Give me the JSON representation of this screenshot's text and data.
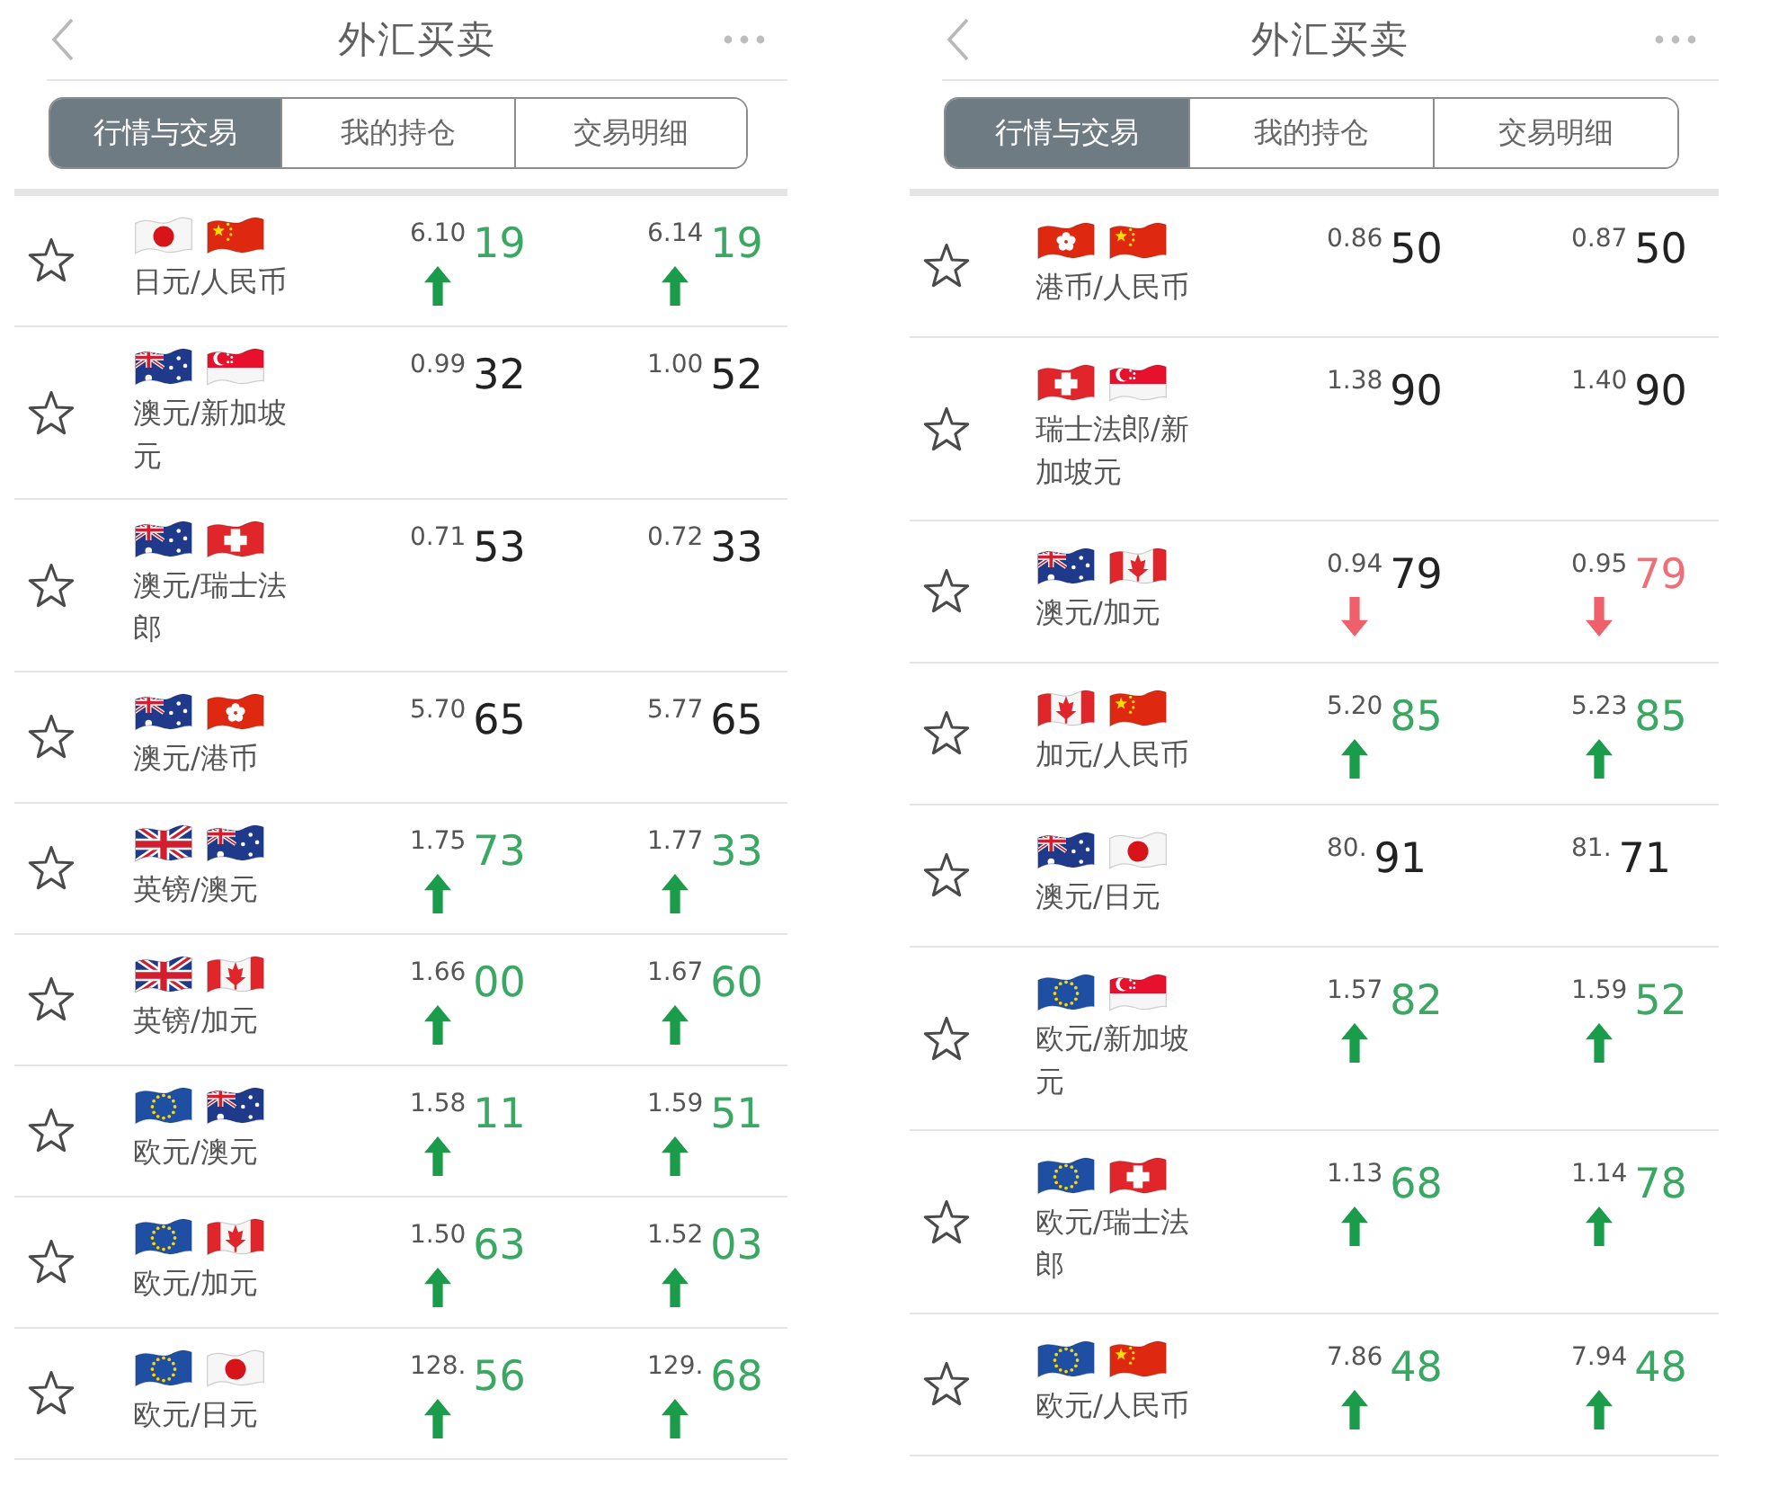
{
  "panels": [
    {
      "header": {
        "title": "外汇买卖"
      },
      "tabs": [
        {
          "label": "行情与交易",
          "selected": true
        },
        {
          "label": "我的持仓",
          "selected": false
        },
        {
          "label": "交易明细",
          "selected": false
        }
      ],
      "rows": [
        {
          "starred": false,
          "flags": [
            {
              "kind": "japan"
            },
            {
              "kind": "china"
            }
          ],
          "pair": "日元/人民币",
          "quotes": [
            {
              "lead": "6.10",
              "pips": "19",
              "color": "#3aa862",
              "rising": true,
              "falling": false
            },
            {
              "lead": "6.14",
              "pips": "19",
              "color": "#3aa862",
              "rising": true,
              "falling": false
            }
          ]
        },
        {
          "starred": false,
          "flags": [
            {
              "kind": "australia"
            },
            {
              "kind": "singapore"
            }
          ],
          "pair": "澳元/新加坡元",
          "quotes": [
            {
              "lead": "0.99",
              "pips": "32",
              "color": "#222222",
              "rising": false,
              "falling": false
            },
            {
              "lead": "1.00",
              "pips": "52",
              "color": "#222222",
              "rising": false,
              "falling": false
            }
          ]
        },
        {
          "starred": false,
          "flags": [
            {
              "kind": "australia"
            },
            {
              "kind": "switzerland"
            }
          ],
          "pair": "澳元/瑞士法郎",
          "quotes": [
            {
              "lead": "0.71",
              "pips": "53",
              "color": "#222222",
              "rising": false,
              "falling": false
            },
            {
              "lead": "0.72",
              "pips": "33",
              "color": "#222222",
              "rising": false,
              "falling": false
            }
          ]
        },
        {
          "starred": false,
          "flags": [
            {
              "kind": "australia"
            },
            {
              "kind": "hongkong"
            }
          ],
          "pair": "澳元/港币",
          "quotes": [
            {
              "lead": "5.70",
              "pips": "65",
              "color": "#222222",
              "rising": false,
              "falling": false
            },
            {
              "lead": "5.77",
              "pips": "65",
              "color": "#222222",
              "rising": false,
              "falling": false
            }
          ]
        },
        {
          "starred": false,
          "flags": [
            {
              "kind": "uk"
            },
            {
              "kind": "australia"
            }
          ],
          "pair": "英镑/澳元",
          "quotes": [
            {
              "lead": "1.75",
              "pips": "73",
              "color": "#3aa862",
              "rising": true,
              "falling": false
            },
            {
              "lead": "1.77",
              "pips": "33",
              "color": "#3aa862",
              "rising": true,
              "falling": false
            }
          ]
        },
        {
          "starred": false,
          "flags": [
            {
              "kind": "uk"
            },
            {
              "kind": "canada"
            }
          ],
          "pair": "英镑/加元",
          "quotes": [
            {
              "lead": "1.66",
              "pips": "00",
              "color": "#3aa862",
              "rising": true,
              "falling": false
            },
            {
              "lead": "1.67",
              "pips": "60",
              "color": "#3aa862",
              "rising": true,
              "falling": false
            }
          ]
        },
        {
          "starred": false,
          "flags": [
            {
              "kind": "eu"
            },
            {
              "kind": "australia"
            }
          ],
          "pair": "欧元/澳元",
          "quotes": [
            {
              "lead": "1.58",
              "pips": "11",
              "color": "#3aa862",
              "rising": true,
              "falling": false
            },
            {
              "lead": "1.59",
              "pips": "51",
              "color": "#3aa862",
              "rising": true,
              "falling": false
            }
          ]
        },
        {
          "starred": false,
          "flags": [
            {
              "kind": "eu"
            },
            {
              "kind": "canada"
            }
          ],
          "pair": "欧元/加元",
          "quotes": [
            {
              "lead": "1.50",
              "pips": "63",
              "color": "#3aa862",
              "rising": true,
              "falling": false
            },
            {
              "lead": "1.52",
              "pips": "03",
              "color": "#3aa862",
              "rising": true,
              "falling": false
            }
          ]
        },
        {
          "starred": false,
          "flags": [
            {
              "kind": "eu"
            },
            {
              "kind": "japan"
            }
          ],
          "pair": "欧元/日元",
          "quotes": [
            {
              "lead": "128.",
              "pips": "56",
              "color": "#3aa862",
              "rising": true,
              "falling": false
            },
            {
              "lead": "129.",
              "pips": "68",
              "color": "#3aa862",
              "rising": true,
              "falling": false
            }
          ]
        }
      ]
    },
    {
      "header": {
        "title": "外汇买卖"
      },
      "tabs": [
        {
          "label": "行情与交易",
          "selected": true
        },
        {
          "label": "我的持仓",
          "selected": false
        },
        {
          "label": "交易明细",
          "selected": false
        }
      ],
      "rows": [
        {
          "starred": false,
          "flags": [
            {
              "kind": "hongkong"
            },
            {
              "kind": "china"
            }
          ],
          "pair": "港币/人民币",
          "quotes": [
            {
              "lead": "0.86",
              "pips": "50",
              "color": "#222222",
              "rising": false,
              "falling": false
            },
            {
              "lead": "0.87",
              "pips": "50",
              "color": "#222222",
              "rising": false,
              "falling": false
            }
          ]
        },
        {
          "starred": false,
          "flags": [
            {
              "kind": "switzerland"
            },
            {
              "kind": "singapore"
            }
          ],
          "pair": "瑞士法郎/新加坡元",
          "quotes": [
            {
              "lead": "1.38",
              "pips": "90",
              "color": "#222222",
              "rising": false,
              "falling": false
            },
            {
              "lead": "1.40",
              "pips": "90",
              "color": "#222222",
              "rising": false,
              "falling": false
            }
          ]
        },
        {
          "starred": false,
          "flags": [
            {
              "kind": "australia"
            },
            {
              "kind": "canada"
            }
          ],
          "pair": "澳元/加元",
          "quotes": [
            {
              "lead": "0.94",
              "pips": "79",
              "color": "#222222",
              "rising": false,
              "falling": true
            },
            {
              "lead": "0.95",
              "pips": "79",
              "color": "#ef6f76",
              "rising": false,
              "falling": true
            }
          ]
        },
        {
          "starred": false,
          "flags": [
            {
              "kind": "canada"
            },
            {
              "kind": "china"
            }
          ],
          "pair": "加元/人民币",
          "quotes": [
            {
              "lead": "5.20",
              "pips": "85",
              "color": "#3aa862",
              "rising": true,
              "falling": false
            },
            {
              "lead": "5.23",
              "pips": "85",
              "color": "#3aa862",
              "rising": true,
              "falling": false
            }
          ]
        },
        {
          "starred": false,
          "flags": [
            {
              "kind": "australia"
            },
            {
              "kind": "japan"
            }
          ],
          "pair": "澳元/日元",
          "quotes": [
            {
              "lead": "80.",
              "pips": "91",
              "color": "#222222",
              "rising": false,
              "falling": false
            },
            {
              "lead": "81.",
              "pips": "71",
              "color": "#222222",
              "rising": false,
              "falling": false
            }
          ]
        },
        {
          "starred": false,
          "flags": [
            {
              "kind": "eu"
            },
            {
              "kind": "singapore"
            }
          ],
          "pair": "欧元/新加坡元",
          "quotes": [
            {
              "lead": "1.57",
              "pips": "82",
              "color": "#3aa862",
              "rising": true,
              "falling": false
            },
            {
              "lead": "1.59",
              "pips": "52",
              "color": "#3aa862",
              "rising": true,
              "falling": false
            }
          ]
        },
        {
          "starred": false,
          "flags": [
            {
              "kind": "eu"
            },
            {
              "kind": "switzerland"
            }
          ],
          "pair": "欧元/瑞士法郎",
          "quotes": [
            {
              "lead": "1.13",
              "pips": "68",
              "color": "#3aa862",
              "rising": true,
              "falling": false
            },
            {
              "lead": "1.14",
              "pips": "78",
              "color": "#3aa862",
              "rising": true,
              "falling": false
            }
          ]
        },
        {
          "starred": false,
          "flags": [
            {
              "kind": "eu"
            },
            {
              "kind": "china"
            }
          ],
          "pair": "欧元/人民币",
          "quotes": [
            {
              "lead": "7.86",
              "pips": "48",
              "color": "#3aa862",
              "rising": true,
              "falling": false
            },
            {
              "lead": "7.94",
              "pips": "48",
              "color": "#3aa862",
              "rising": true,
              "falling": false
            }
          ]
        }
      ]
    }
  ]
}
